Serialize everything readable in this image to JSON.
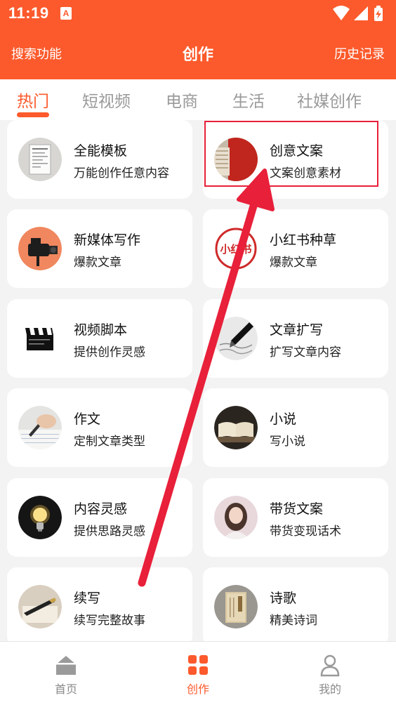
{
  "status": {
    "time": "11:19",
    "notif_letter": "A"
  },
  "header": {
    "left": "搜索功能",
    "title": "创作",
    "right": "历史记录"
  },
  "tabs": [
    {
      "label": "热门"
    },
    {
      "label": "短视频"
    },
    {
      "label": "电商"
    },
    {
      "label": "生活"
    },
    {
      "label": "社媒创作"
    }
  ],
  "cards": [
    {
      "title": "全能模板",
      "subtitle": "万能创作任意内容",
      "icon": "document-template-icon"
    },
    {
      "title": "创意文案",
      "subtitle": "文案创意素材",
      "icon": "red-book-icon"
    },
    {
      "title": "新媒体写作",
      "subtitle": "爆款文章",
      "icon": "video-camera-icon"
    },
    {
      "title": "小红书种草",
      "subtitle": "爆款文章",
      "icon": "xiaohongshu-logo-icon",
      "logo_text": "小红书"
    },
    {
      "title": "视频脚本",
      "subtitle": "提供创作灵感",
      "icon": "clapperboard-icon"
    },
    {
      "title": "文章扩写",
      "subtitle": "扩写文章内容",
      "icon": "fountain-pen-icon"
    },
    {
      "title": "作文",
      "subtitle": "定制文章类型",
      "icon": "writing-hand-icon"
    },
    {
      "title": "小说",
      "subtitle": "写小说",
      "icon": "open-book-icon"
    },
    {
      "title": "内容灵感",
      "subtitle": "提供思路灵感",
      "icon": "light-bulb-icon"
    },
    {
      "title": "带货文案",
      "subtitle": "带货变现话术",
      "icon": "woman-portrait-icon"
    },
    {
      "title": "续写",
      "subtitle": "续写完整故事",
      "icon": "pen-notebook-icon"
    },
    {
      "title": "诗歌",
      "subtitle": "精美诗词",
      "icon": "poetry-book-icon"
    }
  ],
  "bottom_nav": [
    {
      "label": "首页",
      "icon": "home-icon"
    },
    {
      "label": "创作",
      "icon": "grid-icon"
    },
    {
      "label": "我的",
      "icon": "user-icon"
    }
  ],
  "colors": {
    "accent": "#fc5a2c",
    "annotation": "#e8203a",
    "inactive": "#9a9a9a"
  }
}
